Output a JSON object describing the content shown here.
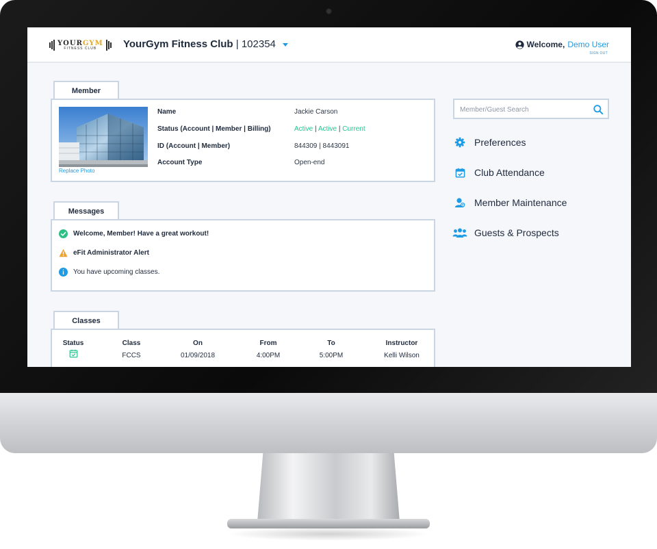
{
  "header": {
    "logo": {
      "line1_a": "YOUR",
      "line1_b": "GYM",
      "line2": "FITNESS CLUB"
    },
    "club_name": "YourGym Fitness Club",
    "club_separator": "|",
    "club_id": "102354",
    "welcome_label": "Welcome,",
    "user_name": "Demo User",
    "sign_out": "SIGN OUT"
  },
  "member": {
    "tab_label": "Member",
    "replace_photo": "Replace Photo",
    "fields": [
      {
        "label": "Name",
        "value": "Jackie Carson"
      },
      {
        "label": "Status (Account | Member | Billing)",
        "values": [
          "Active",
          "Active",
          "Current"
        ]
      },
      {
        "label": "ID (Account | Member)",
        "value": "844309 | 8443091"
      },
      {
        "label": "Account Type",
        "value": "Open-end"
      }
    ]
  },
  "messages": {
    "tab_label": "Messages",
    "items": [
      {
        "icon": "check-circle-icon",
        "text": "Welcome, Member! Have a great workout!",
        "bold": true,
        "color": "#2dbf84"
      },
      {
        "icon": "warning-icon",
        "text": "eFit Administrator Alert",
        "bold": true,
        "color": "#f0a22b"
      },
      {
        "icon": "info-circle-icon",
        "text": "You have upcoming classes.",
        "bold": false,
        "color": "#1e9be5"
      }
    ]
  },
  "classes": {
    "tab_label": "Classes",
    "columns": [
      "Status",
      "Class",
      "On",
      "From",
      "To",
      "Instructor"
    ],
    "rows": [
      {
        "status_icon": "calendar-check-icon",
        "class": "FCCS",
        "on": "01/09/2018",
        "from": "4:00PM",
        "to": "5:00PM",
        "instructor": "Kelli Wilson"
      }
    ]
  },
  "sidebar": {
    "search_placeholder": "Member/Guest Search",
    "items": [
      {
        "label": "Preferences",
        "icon": "gear-icon"
      },
      {
        "label": "Club Attendance",
        "icon": "calendar-check-icon"
      },
      {
        "label": "Member Maintenance",
        "icon": "member-maintenance-icon"
      },
      {
        "label": "Guests & Prospects",
        "icon": "users-group-icon"
      }
    ]
  },
  "colors": {
    "accent": "#1e9be5",
    "status_green": "#28c48f",
    "panel_border": "#c9d5e2",
    "text": "#1f2a3c"
  }
}
